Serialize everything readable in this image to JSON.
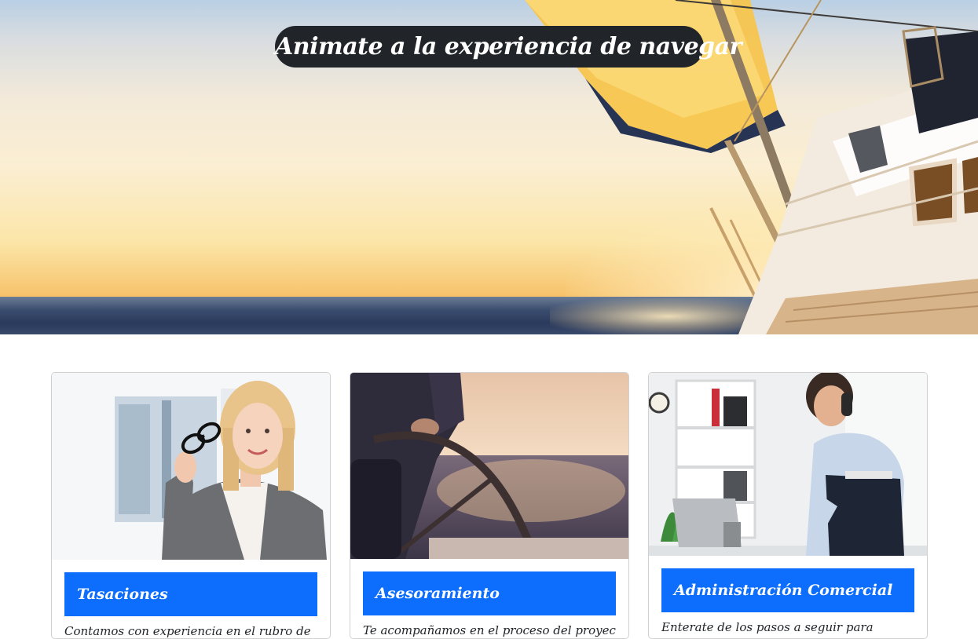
{
  "hero": {
    "title": "Animate a la experiencia de navegar",
    "image": "sailboat-at-sunset"
  },
  "cards": [
    {
      "image": "businesswoman-holding-glasses",
      "title": "Tasaciones",
      "text": "Contamos con experiencia en el rubro de"
    },
    {
      "image": "hands-on-boat-steering-wheel",
      "title": "Asesoramiento",
      "text": "Te acompañamos en el proceso del proyecto"
    },
    {
      "image": "businesswoman-on-phone-in-office",
      "title": "Administración Comercial",
      "text": "Enterate de los pasos a seguir para"
    }
  ],
  "colors": {
    "title_pill": "#212529",
    "card_title_bar": "#0d6efd",
    "text": "#212529"
  }
}
